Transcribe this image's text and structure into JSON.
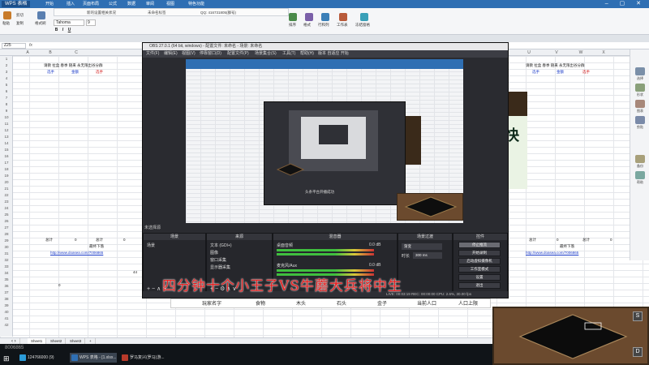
{
  "wps": {
    "badge": "WPS 表格",
    "menu": [
      "开始",
      "插入",
      "页面布局",
      "公式",
      "数据",
      "审阅",
      "视图",
      "特色功能"
    ],
    "doc_tabs": [
      "新的设置相关状况",
      "未命名标签",
      "QQ: 416731805(群号)"
    ],
    "font_name": "Tahoma",
    "font_size": "9",
    "ribbon_labels": [
      "粘贴",
      "剪切",
      "复制",
      "格式刷",
      "排序",
      "格式",
      "行和列",
      "工作表",
      "冻结窗格"
    ],
    "name_box": "Z25",
    "fx": "fx",
    "columns": [
      "A",
      "B",
      "C",
      "U",
      "V",
      "W",
      "X"
    ],
    "rows": [
      "1",
      "2",
      "3",
      "4",
      "5",
      "6",
      "7",
      "8",
      "9",
      "10",
      "11",
      "12",
      "13",
      "14",
      "15",
      "16",
      "17",
      "18",
      "19",
      "20",
      "21",
      "22",
      "23",
      "24",
      "25",
      "26",
      "27",
      "28",
      "29",
      "30",
      "31",
      "32",
      "33",
      "34",
      "35",
      "36",
      "37",
      "38",
      "39",
      "40",
      "41",
      "42"
    ],
    "header_row": "请教  拉盒  春季  随来  永无限出谷分群",
    "sub_labels": [
      "选手",
      "金额",
      "选手"
    ],
    "total_label": "总计",
    "total_value": "0",
    "footer_label": "最终下落",
    "footer_link": "http://www.doasea.com/7006865",
    "cell_36": "0",
    "cell_44": "44",
    "sheet_tabs": [
      "Sheet1",
      "Sheet2",
      "Sheet3"
    ],
    "add_sheet": "+",
    "bottom_id": "8006865"
  },
  "right_rail": {
    "labels": [
      "选择",
      "形状",
      "图表",
      "剪贴",
      "备份",
      "帮助"
    ]
  },
  "obs": {
    "title": "OBS 27.0.1 (64 bit, windows) - 配置文件: 未命名 - 场景: 未命名",
    "menu": [
      "文件(F)",
      "编辑(E)",
      "视图(V)",
      "停靠窗口(D)",
      "配置文件(P)",
      "场景集合(S)",
      "工具(T)",
      "帮助(H)",
      "版本 自适应 开始"
    ],
    "scene_bar_text": "未选择源",
    "panel_headers": [
      "场景",
      "来源",
      "混音器",
      "场景过渡",
      "控件"
    ],
    "scene_item": "场景",
    "sources": [
      "文本 (GDI+)",
      "图像",
      "窗口采集",
      "显示器采集"
    ],
    "mixer": [
      {
        "name": "桌面音频",
        "level": "0.0 dB"
      },
      {
        "name": "麦克风/Aux",
        "level": "0.0 dB"
      }
    ],
    "transition": {
      "type": "渐变",
      "duration_label": "时长",
      "duration": "300 ms"
    },
    "controls": [
      "停止推流",
      "开始录制",
      "启动虚拟摄像机",
      "工作室模式",
      "设置",
      "退出"
    ],
    "status": "LIVE: 00:03:19   REC: 00:00:00   CPU: 2.6%, 30.00 fps",
    "nested_caption": "头条平台开播成功"
  },
  "overlay_text": "四分钟十个小王子VS牛蘑大兵将中生",
  "strip_columns": [
    "玩家名字",
    "食物",
    "木头",
    "石头",
    "金子",
    "当前人口",
    "人口上限"
  ],
  "web_fragment_char": "快",
  "taskbar": {
    "items": [
      "124766000 (9)",
      "WPS 表格 - [1.xlsx...",
      "罗马复兴(罗马)游..."
    ]
  },
  "colors": {
    "wps_blue": "#2f6fb3",
    "obs_bg": "#2a2b30",
    "overlay_red": "#e62222",
    "link_blue": "#1c3cc8"
  }
}
